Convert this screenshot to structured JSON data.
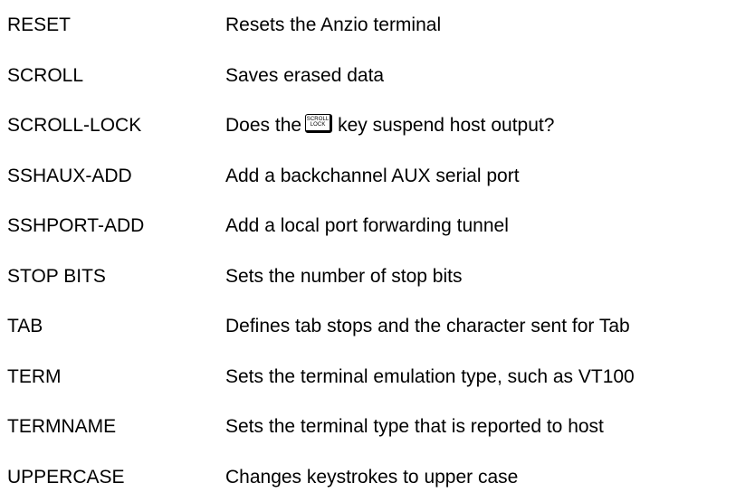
{
  "commands": [
    {
      "name": "RESET",
      "description": "Resets the Anzio terminal"
    },
    {
      "name": "SCROLL",
      "description": "Saves erased data"
    },
    {
      "name": "SCROLL-LOCK",
      "description_before": "Does the",
      "key_icon": {
        "name": "scroll-lock-key-icon",
        "line1": "SCROLL",
        "line2": "LOCK"
      },
      "description_after": "key suspend host output?"
    },
    {
      "name": "SSHAUX-ADD",
      "description": "Add a backchannel AUX serial port"
    },
    {
      "name": "SSHPORT-ADD",
      "description": "Add a local port forwarding tunnel"
    },
    {
      "name": "STOP BITS",
      "description": "Sets the number of stop bits"
    },
    {
      "name": "TAB",
      "description": "Defines tab stops and the character sent for Tab"
    },
    {
      "name": "TERM",
      "description": "Sets the terminal emulation type, such as VT100"
    },
    {
      "name": "TERMNAME",
      "description": "Sets the terminal type that is reported to host"
    },
    {
      "name": "UPPERCASE",
      "description": "Changes keystrokes to upper case"
    }
  ]
}
